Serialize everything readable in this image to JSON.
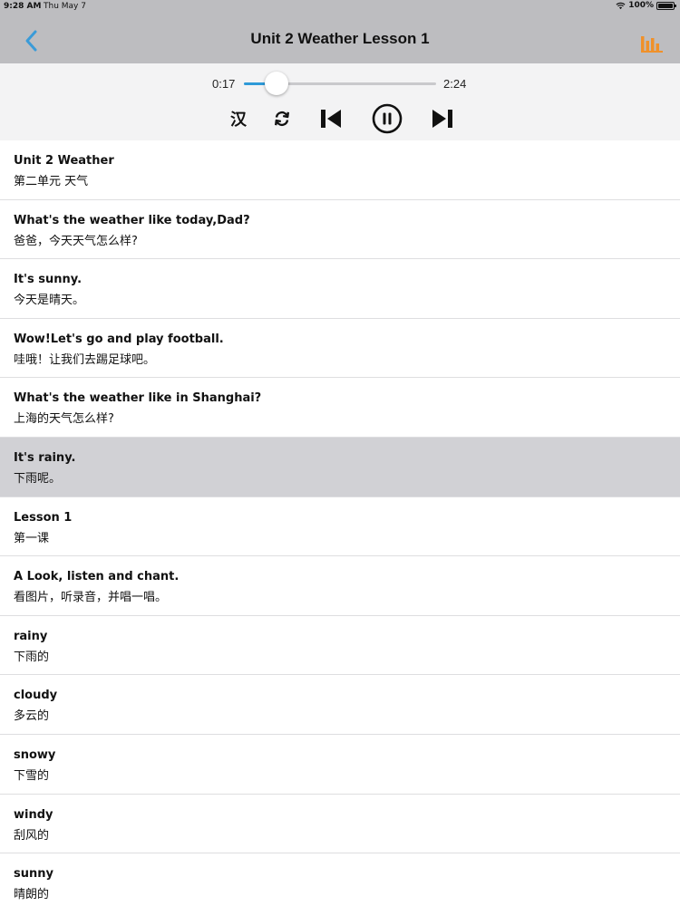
{
  "status": {
    "time": "9:28 AM",
    "date": "Thu May 7",
    "battery": "100%"
  },
  "nav": {
    "title": "Unit 2 Weather Lesson 1"
  },
  "player": {
    "current_time": "0:17",
    "total_time": "2:24",
    "progress": 0.17,
    "han_toggle_label": "汉"
  },
  "colors": {
    "accent_blue": "#2e9ad8",
    "chart_orange": "#f0912a",
    "selected_row": "#d1d1d5"
  },
  "list": {
    "selected_index": 5,
    "items": [
      {
        "en": "Unit 2 Weather",
        "zh": "第二单元 天气"
      },
      {
        "en": "What's the weather like today,Dad?",
        "zh": "爸爸，今天天气怎么样?"
      },
      {
        "en": "It's sunny.",
        "zh": "今天是晴天。"
      },
      {
        "en": "Wow!Let's go and play football.",
        "zh": "哇哦！让我们去踢足球吧。"
      },
      {
        "en": "What's the weather like in Shanghai?",
        "zh": "上海的天气怎么样?"
      },
      {
        "en": "It's rainy.",
        "zh": "下雨呢。"
      },
      {
        "en": "Lesson 1",
        "zh": "第一课"
      },
      {
        "en": "A Look, listen and chant.",
        "zh": "看图片，听录音，并唱一唱。"
      },
      {
        "en": "rainy",
        "zh": "下雨的"
      },
      {
        "en": "cloudy",
        "zh": "多云的"
      },
      {
        "en": "snowy",
        "zh": "下雪的"
      },
      {
        "en": "windy",
        "zh": "刮风的"
      },
      {
        "en": "sunny",
        "zh": "晴朗的"
      }
    ]
  }
}
